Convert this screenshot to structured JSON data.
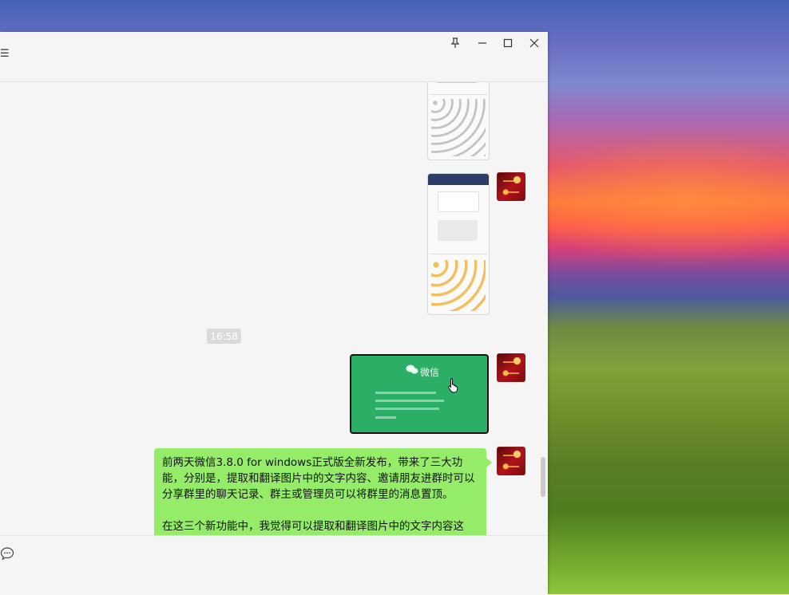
{
  "window": {
    "menu_glyph": "☰",
    "controls": {
      "pin": "pin-icon",
      "minimize": "minimize-icon",
      "maximize": "maximize-icon",
      "close": "close-icon"
    }
  },
  "chat": {
    "timestamp": "16:58",
    "card": {
      "title": "微信"
    },
    "message_text": "前两天微信3.8.0 for windows正式版全新发布，带来了三大功能，分别是，提取和翻译图片中的文字内容、邀请朋友进群时可以分享群里的聊天记录、群主或管理员可以将群里的消息置顶。\n\n在这三个新功能中，我觉得可以提取和翻译图片中的文字内容这"
  },
  "colors": {
    "bubble": "#95ec69",
    "card": "#2bae66",
    "window_bg": "#f5f5f5"
  }
}
